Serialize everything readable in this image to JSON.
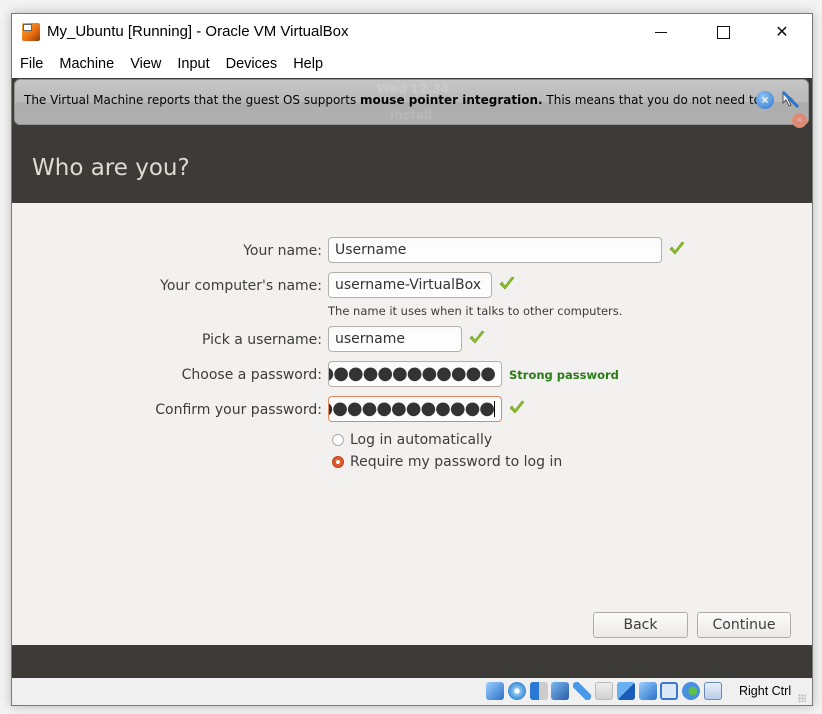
{
  "window": {
    "title": "My_Ubuntu [Running] - Oracle VM VirtualBox",
    "controls": {
      "minimize": "minimize",
      "maximize": "maximize",
      "close": "close"
    }
  },
  "menubar": {
    "items": [
      {
        "label": "File"
      },
      {
        "label": "Machine"
      },
      {
        "label": "View"
      },
      {
        "label": "Input"
      },
      {
        "label": "Devices"
      },
      {
        "label": "Help"
      }
    ]
  },
  "guest": {
    "top_panel": {
      "clock": "Wed 12:34"
    },
    "installer_title": "Install",
    "notice": {
      "text_before": "The Virtual Machine reports that the guest OS supports ",
      "text_bold": "mouse pointer integration.",
      "text_after": " This means that you do not need to"
    },
    "page_title": "Who are you?",
    "form": {
      "your_name": {
        "label": "Your name:",
        "value": "Username",
        "valid": true
      },
      "computer_name": {
        "label": "Your computer's name:",
        "value": "username-VirtualBox",
        "valid": true,
        "hint": "The name it uses when it talks to other computers."
      },
      "username": {
        "label": "Pick a username:",
        "value": "username",
        "valid": true
      },
      "password": {
        "label": "Choose a password:",
        "masked_value": "●●●●●●●●●●●●●●",
        "strength": "Strong password"
      },
      "confirm_password": {
        "label": "Confirm your password:",
        "masked_value": "●●●●●●●●●●●●●●",
        "valid": true
      },
      "login_options": [
        {
          "label": "Log in automatically",
          "selected": false
        },
        {
          "label": "Require my password to log in",
          "selected": true
        }
      ]
    },
    "buttons": {
      "back": "Back",
      "continue": "Continue"
    }
  },
  "statusbar": {
    "icons": [
      "hard-disk-icon",
      "optical-drive-icon",
      "audio-icon",
      "network-icon",
      "usb-icon",
      "shared-folders-icon",
      "display-icon",
      "video-capture-icon",
      "cpu-virtualization-icon",
      "mouse-integration-icon",
      "keyboard-capture-icon"
    ],
    "host_key": "Right Ctrl"
  },
  "colors": {
    "ubuntu_dark": "#3c3b37",
    "ubuntu_bg": "#f2f1f0",
    "accent_orange": "#dd5b2a",
    "strength_green": "#2a7a16",
    "check_green": "#8cc02c"
  }
}
